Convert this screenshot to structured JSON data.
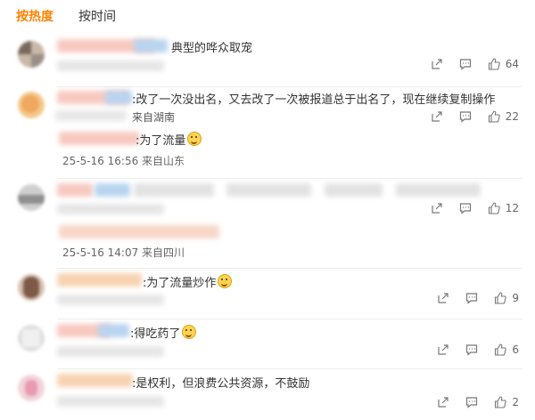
{
  "tabs": [
    {
      "label": "按热度",
      "active": true
    },
    {
      "label": "按时间",
      "active": false
    }
  ],
  "comments": [
    {
      "text": "典型的哗众取宠",
      "likes": "64"
    },
    {
      "text": ":改了一次没出名，又去改了一次被报道总于出名了，现在继续复制操作",
      "meta": "来自湖南",
      "likes": "22",
      "reply": {
        "text": ":为了流量",
        "meta": "25-5-16 16:56 来自山东"
      }
    },
    {
      "likes": "12",
      "reply": {
        "meta": "25-5-16 14:07 来自四川"
      }
    },
    {
      "text": ":为了流量炒作",
      "likes": "9"
    },
    {
      "text": ":得吃药了",
      "likes": "6"
    },
    {
      "text": ":是权利，但浪费公共资源，不鼓励",
      "likes": "2"
    }
  ],
  "icons": {
    "share": "share-icon",
    "comment": "comment-icon",
    "like": "thumbs-up-icon"
  },
  "colors": {
    "accent": "#ff8200",
    "text": "#333333",
    "muted": "#666666"
  }
}
